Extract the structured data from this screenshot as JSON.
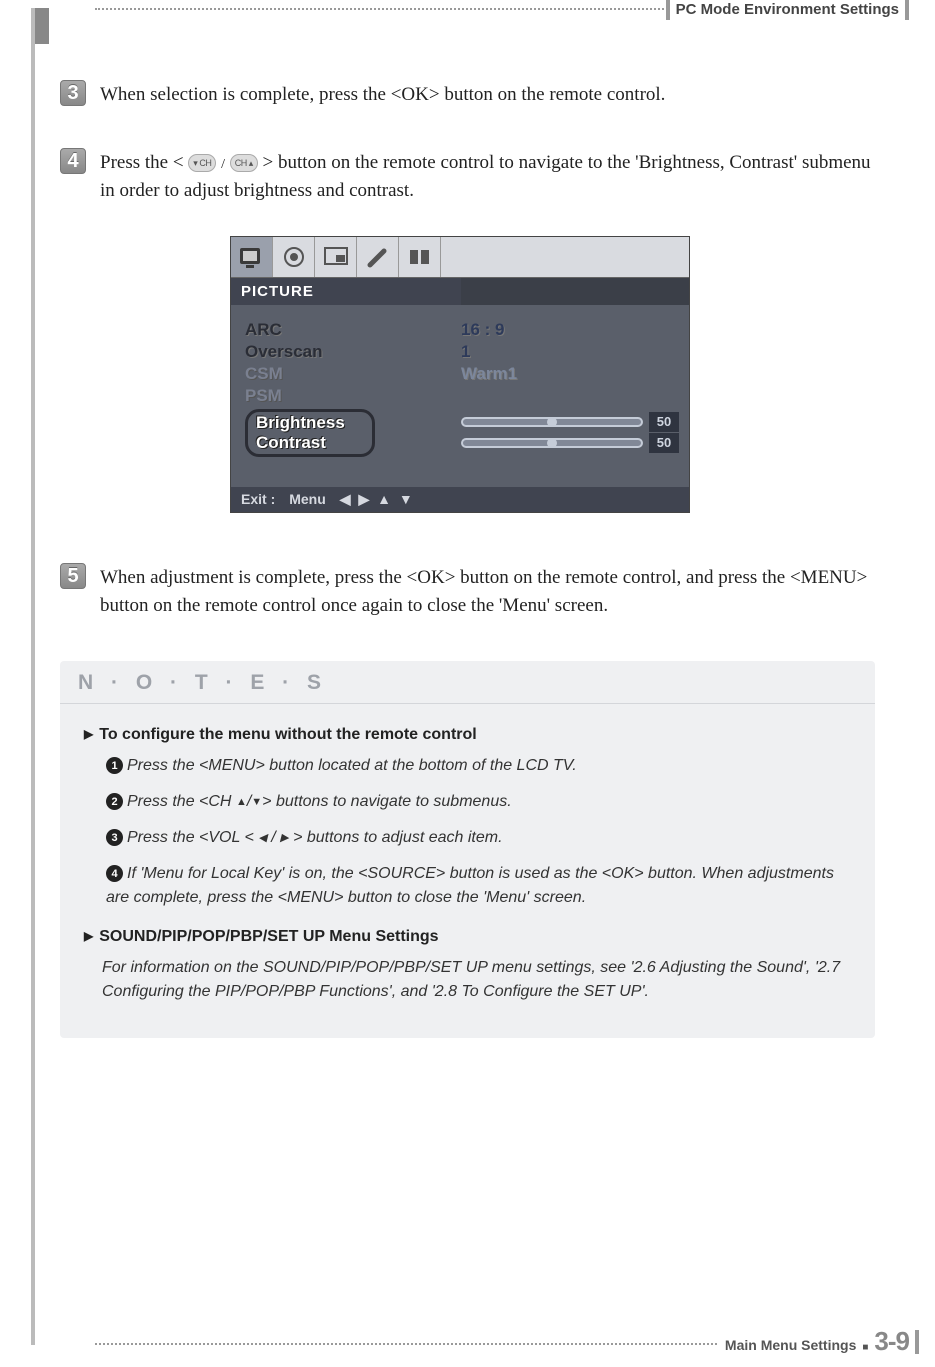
{
  "header": {
    "section_title": "PC Mode Environment Settings"
  },
  "steps": {
    "s3": {
      "num": "3",
      "text": "When selection is complete, press the <OK> button on the remote control."
    },
    "s4": {
      "num": "4",
      "text_before": "Press the <",
      "btn_left": "▾ CH",
      "btn_right": "CH ▴",
      "text_after": "> button on the remote control to navigate to the 'Brightness, Contrast' submenu in order to adjust brightness and contrast."
    },
    "s5": {
      "num": "5",
      "text": "When adjustment is complete, press the <OK> button on the remote control, and press the <MENU> button on the remote control once again to close the 'Menu' screen."
    }
  },
  "osd": {
    "title": "PICTURE",
    "items": {
      "arc": "ARC",
      "overscan": "Overscan",
      "csm": "CSM",
      "psm": "PSM",
      "brightness": "Brightness",
      "contrast": "Contrast"
    },
    "values": {
      "arc": "16 : 9",
      "overscan": "1",
      "csm": "Warm1",
      "brightness": "50",
      "contrast": "50"
    },
    "footer": {
      "exit": "Exit :",
      "menu": "Menu",
      "arrows": "◀ ▶ ▲ ▼"
    }
  },
  "notes": {
    "title": "N · O · T · E · S",
    "head1": "To configure the menu without the remote control",
    "l1": "Press the <MENU> button located at the bottom of the LCD TV.",
    "l2_a": "Press the <CH ",
    "l2_b": "> buttons to navigate to submenus.",
    "l3_a": "Press the <VOL < ",
    "l3_b": " > buttons to adjust each item.",
    "l4": "If 'Menu for Local Key' is on, the <SOURCE> button is used as the <OK> button. When adjustments are complete, press the <MENU> button to close the 'Menu' screen.",
    "head2": "SOUND/PIP/POP/PBP/SET UP Menu Settings",
    "l5": "For information on the SOUND/PIP/POP/PBP/SET UP menu settings, see '2.6 Adjusting the Sound', '2.7 Configuring the PIP/POP/PBP Functions', and '2.8 To Configure the SET UP'."
  },
  "footer": {
    "label": "Main Menu Settings",
    "page": "3-9"
  }
}
